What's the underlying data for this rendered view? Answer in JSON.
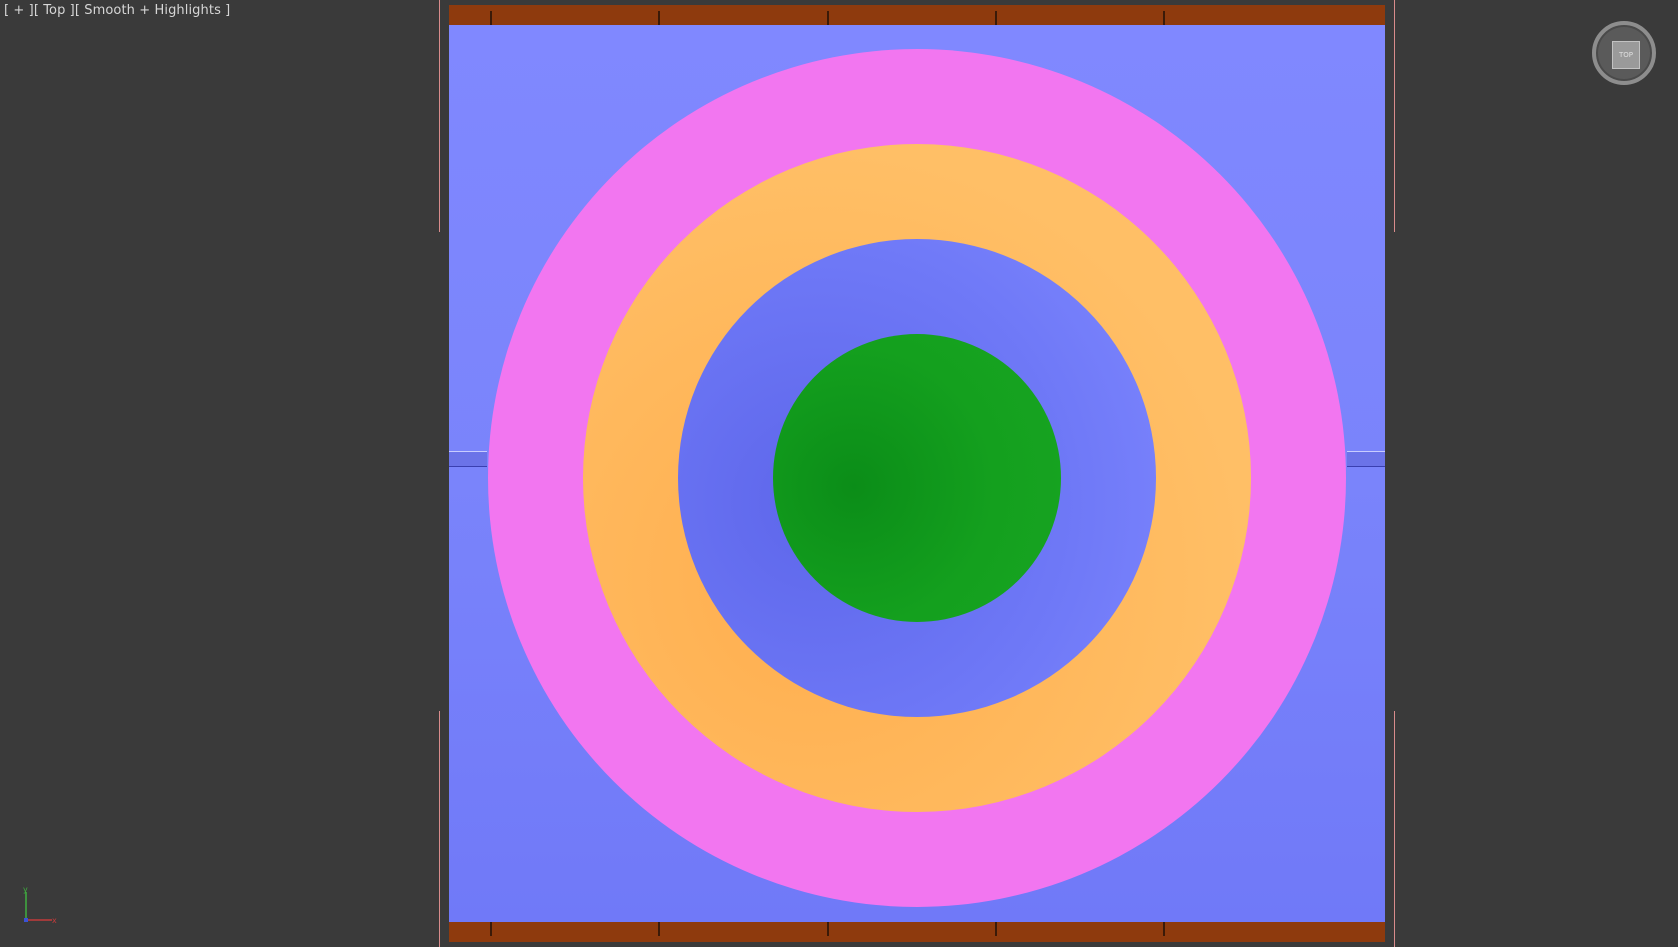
{
  "viewport": {
    "plus": "[ + ]",
    "view": "[ Top ]",
    "shading": "[ Smooth + Highlights ]"
  },
  "viewcube": {
    "face_label": "TOP"
  },
  "axis_tripod": {
    "y_label": "y",
    "x_label": "x"
  },
  "icons": [
    "viewcube-icon",
    "axis-tripod-icon"
  ],
  "colors": {
    "background": "#3a3a3a",
    "plane": "#7a84fb",
    "outer_ring": "#f276f0",
    "middle_ring": "#ffbf66",
    "inner_ring": "#6f79f7",
    "center_disc": "#14a01e",
    "rail": "#8e3a0d"
  }
}
